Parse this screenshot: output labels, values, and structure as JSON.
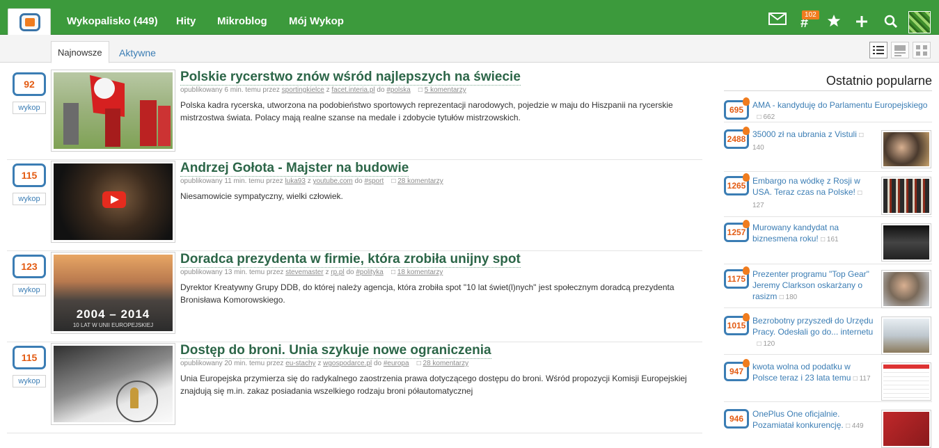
{
  "header": {
    "nav": [
      "Wykopalisko (449)",
      "Hity",
      "Mikroblog",
      "Mój Wykop"
    ],
    "notification_count": "102",
    "icons": [
      "mail-icon",
      "hashtag-icon",
      "star-icon",
      "plus-icon",
      "search-icon"
    ]
  },
  "tabs": {
    "active": "Najnowsze",
    "other": "Aktywne"
  },
  "view_modes": [
    "list-view-icon",
    "thumb-view-icon",
    "grid-view-icon"
  ],
  "wykop_label": "wykop",
  "entries": [
    {
      "votes": "92",
      "title": "Polskie rycerstwo znów wśród najlepszych na świecie",
      "time": "opublikowany 6 min. temu przez",
      "author": "sportingkielce",
      "source": "facet.interia.pl",
      "tag": "#polska",
      "comments": "5 komentarzy",
      "desc": "Polska kadra rycerska, utworzona na podobieństwo sportowych reprezentacji narodowych, pojedzie w maju do Hiszpanii na rycerskie mistrzostwa świata. Polacy mają realne szanse na medale i zdobycie tytułów mistrzowskich."
    },
    {
      "votes": "115",
      "title": "Andrzej Gołota - Majster na budowie",
      "time": "opublikowany 11 min. temu przez",
      "author": "luka93",
      "source": "youtube.com",
      "tag": "#sport",
      "comments": "28 komentarzy",
      "desc": "Niesamowicie sympatyczny, wielki człowiek."
    },
    {
      "votes": "123",
      "title": "Doradca prezydenta w firmie, która zrobiła unijny spot",
      "time": "opublikowany 13 min. temu przez",
      "author": "stevemaster",
      "source": "rp.pl",
      "tag": "#polityka",
      "comments": "18 komentarzy",
      "desc": "Dyrektor Kreatywny Grupy DDB, do której należy agencja, która zrobiła spot \"10 lat świet(l)nych\" jest społecznym doradcą prezydenta Bronisława Komorowskiego.",
      "thumb_text": "2004 – 2014",
      "thumb_sub": "10 LAT W UNII EUROPEJSKIEJ"
    },
    {
      "votes": "115",
      "title": "Dostęp do broni. Unia szykuje nowe ograniczenia",
      "time": "opublikowany 20 min. temu przez",
      "author": "eu-stachy",
      "source": "wgospodarce.pl",
      "tag": "#europa",
      "comments": "28 komentarzy",
      "desc": "Unia Europejska przymierza się do radykalnego zaostrzenia prawa dotyczącego dostępu do broni. Wśród propozycji Komisji Europejskiej znajdują się m.in. zakaz posiadania wszelkiego rodzaju broni półautomatycznej"
    }
  ],
  "sidebar": {
    "title": "Ostatnio popularne",
    "items": [
      {
        "votes": "695",
        "l1": "AMA - kandyduję do Parlamentu Europejskiego",
        "l2": "",
        "l3": "",
        "cnt": "662"
      },
      {
        "votes": "2488",
        "l1": "35000 zł na ubrania z Vistuli",
        "l2": "",
        "l3": "",
        "cnt": "140"
      },
      {
        "votes": "1265",
        "l1": "Embargo na wódkę z Rosji w",
        "l2": "USA. Teraz czas na Polske!",
        "l3": "",
        "cnt": "127"
      },
      {
        "votes": "1257",
        "l1": "Murowany kandydat na",
        "l2": "biznesmena roku!",
        "l3": "",
        "cnt": "161"
      },
      {
        "votes": "1175",
        "l1": "Prezenter programu \"Top Gear\"",
        "l2": "Jeremy Clarkson oskarżany o",
        "l3": "rasizm",
        "cnt": "180"
      },
      {
        "votes": "1015",
        "l1": "Bezrobotny przyszedł do Urzędu",
        "l2": "Pracy. Odesłali go do... internetu",
        "l3": "",
        "cnt": "120"
      },
      {
        "votes": "947",
        "l1": "kwota wolna od podatku w",
        "l2": "Polsce teraz i 23 lata temu",
        "l3": "",
        "cnt": "117"
      },
      {
        "votes": "946",
        "l1": "OnePlus One oficjalnie.",
        "l2": "Pozamiatał konkurencję.",
        "l3": "",
        "cnt": "449"
      }
    ]
  }
}
